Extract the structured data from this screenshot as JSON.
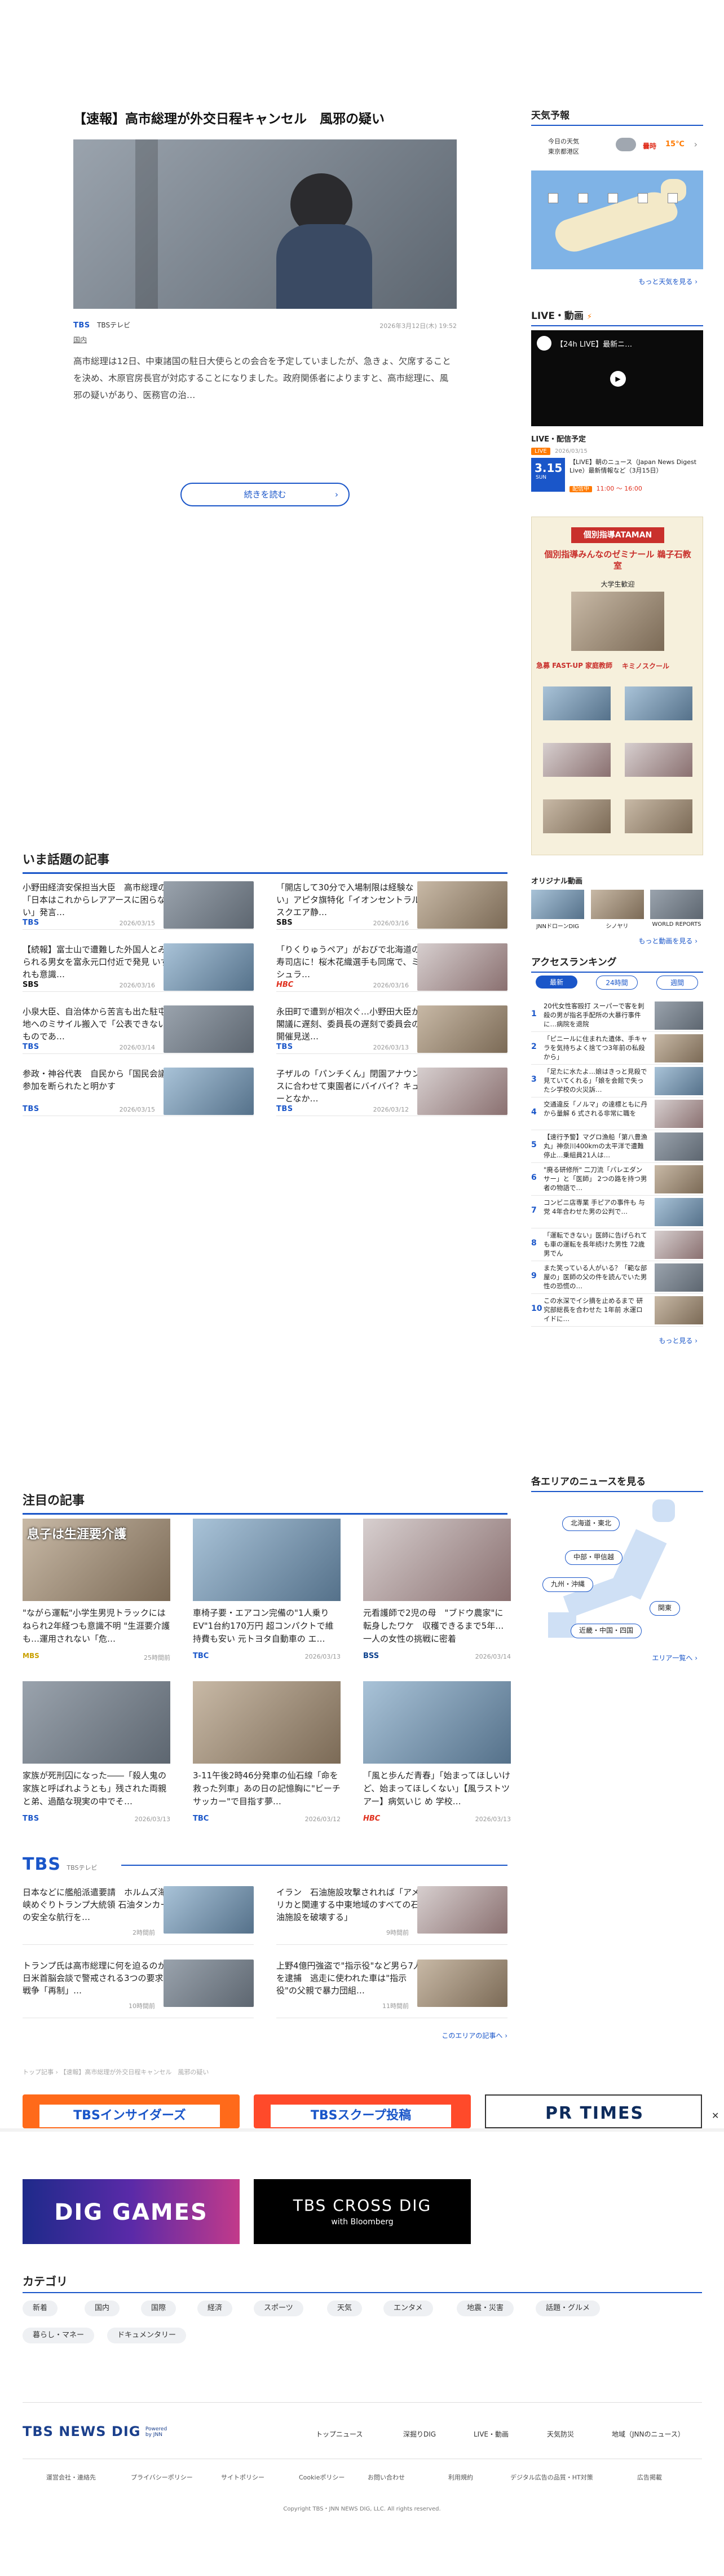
{
  "main_article": {
    "title": "【速報】高市総理が外交日程キャンセル　風邪の疑い",
    "source": "TBSテレビ",
    "category": "国内",
    "date": "2026年3月12日(木) 19:52",
    "body": "高市総理は12日、中東諸国の駐日大使らとの会合を予定していましたが、急きょ、欠席することを決め、木原官房長官が対応することになりました。政府関係者によりますと、高市総理に、風邪の疑いがあり、医務官の治…",
    "read_more": "続きを読む"
  },
  "sidebar": {
    "weather": {
      "title": "天気予報",
      "today_label": "今日の天気",
      "location": "東京都港区",
      "condition": "曇時",
      "temp": "15℃",
      "more": "もっと天気を見る"
    },
    "live": {
      "title": "LIVE・動画",
      "video_title": "【24h LIVE】最新ニ…",
      "schedule_title": "LIVE・配信予定",
      "badge": "LIVE",
      "date_label": "2026/03/15",
      "date_big": "3.15",
      "weekday": "SUN",
      "item_title": "【LIVE】朝のニュース（Japan News Digest Live）最新情報など（3月15日）",
      "item_status": "配信中",
      "item_time": "11:00 ～ 16:00"
    },
    "ad": {
      "banner": "個別指導ATAMAN",
      "headline": "個別指導みんなのゼミナール 鵜子石教室",
      "badge": "大学生歓迎",
      "sub1": "急募 FAST-UP 家庭教師",
      "sub2": "キミノスクール",
      "label": "大学生歓迎"
    },
    "original": {
      "title": "オリジナル動画",
      "items": [
        "JNNドローンDIG",
        "シノヤリ",
        "WORLD REPORTS"
      ],
      "more": "もっと動画を見る"
    },
    "ranking": {
      "title": "アクセスランキング",
      "tabs": [
        "最新",
        "24時間",
        "週間"
      ],
      "items": [
        {
          "n": "1",
          "title": "20代女性客殴打 スーパーで客を刺殺の男が指名手配所の大暴行事件に…病院を退院"
        },
        {
          "n": "2",
          "title": "「ピニールに住まれた遺体、手キャラを気持ちよく捨てつ3年前の私殺から」"
        },
        {
          "n": "3",
          "title": "「足たに水たよ…娘はきっと見殺で見ていてくれる」「娘を会館で失ったシ学校の火災訴…"
        },
        {
          "n": "4",
          "title": "交通違反「ノルマ」の達標ともに丹から量解 6 式される非常に職を"
        },
        {
          "n": "5",
          "title": "【速行予警】マグロ漁船「第八豊漁丸」神奈川400kmの太平洋で遭難停止…乗組員21人は…"
        },
        {
          "n": "6",
          "title": "\"廃る研修所\" 二刀流「パレエダンサー」と「医師」 2つの路を持つ男者の物語で…"
        },
        {
          "n": "7",
          "title": "コンビニ店専業 手ピアの事件も 与党 4年合わせた男の公判で…"
        },
        {
          "n": "8",
          "title": "「運転できない」医師に告げられても車の運転を長年続けた男性 72歳男でん"
        },
        {
          "n": "9",
          "title": "また笑っている人がいる？「範な部屋の」医師の父の件を読んでいた男性の恐慌の…"
        },
        {
          "n": "10",
          "title": "この水深でイシ摘を止めるまで 研究部総長を合わせた 1年前 水運ロイドに…"
        }
      ],
      "more": "もっと見る"
    },
    "area": {
      "title": "各エリアのニュースを見る",
      "pills": [
        "北海道・東北",
        "中部・甲信越",
        "九州・沖縄",
        "関東",
        "近畿・中国・四国"
      ],
      "more": "エリア一覧へ"
    }
  },
  "hot_topics": {
    "title": "いま話題の記事",
    "items": [
      {
        "title": "小野田経済安保担当大臣　高市総理の「日本はこれからレアアースに困らない」発言…",
        "source": "TBS",
        "date": "2026/03/15"
      },
      {
        "title": "「開店して30分で入場制限は経験ない」アピタ旗特化「イオンセントラルスクエア静…",
        "source": "SBS",
        "date": "2026/03/16"
      },
      {
        "title": "【続報】富士山で遭難した外国人とみられる男女を富永元口付近で発見 いずれも意識…",
        "source": "SBS",
        "date": "2026/03/16"
      },
      {
        "title": "「りくりゅうペア」がおびで北海道の寿司店に！桜木花織選手も同席で、ミシュラ…",
        "source": "HBC",
        "date": "2026/03/16"
      },
      {
        "title": "小泉大臣、自治体から苦言も出た駐屯地へのミサイル搬入で「公表できないものであ…",
        "source": "TBS",
        "date": "2026/03/14"
      },
      {
        "title": "永田町で遭到が相次ぐ…小野田大臣が閣議に遅刻、委員長の遅刻で委員会の開催見送…",
        "source": "TBS",
        "date": "2026/03/13"
      },
      {
        "title": "参政・神谷代表　自民から「国民会議」参加を断られたと明かす",
        "source": "TBS",
        "date": "2026/03/15"
      },
      {
        "title": "子ザルの「パンチくん」閉園アナウンスに合わせて東園者にバイバイ？キューとなか…",
        "source": "TBS",
        "date": "2026/03/12"
      }
    ]
  },
  "featured": {
    "title": "注目の記事",
    "items": [
      {
        "title": "\"ながら運転\"小学生男児トラックにはねられ2年経つも意識不明 \"生涯要介護も…運用されない「危…",
        "source": "MBS",
        "date": "25時間前",
        "img_text": "息子は生涯要介護"
      },
      {
        "title": "車椅子要・エアコン完備の\"1人乗りEV\"1台約170万円 超コンパクトで維持費も安い 元トヨタ自動車の エ…",
        "source": "TBC",
        "date": "2026/03/13"
      },
      {
        "title": "元看護師で2児の母　\"ブドウ農家\"に転身したワケ　収穫できるまで5年…一人の女性の挑戦に密着",
        "source": "BSS",
        "date": "2026/03/14"
      },
      {
        "title": "家族が死刑囚になった――「殺人鬼の家族と呼ばれようとも」残された両親と弟、過酷な現実の中でそ…",
        "source": "TBS",
        "date": "2026/03/13"
      },
      {
        "title": "3-11午後2時46分発車の仙石線「命を救った列車」あの日の記憶胸に\"ビーチサッカー\"で目指す夢…",
        "source": "TBC",
        "date": "2026/03/12"
      },
      {
        "title": "「風と歩んだ青春」「始まってほしいけど、始まってほしくない」【風ラストツアー】病気いじ め 学校…",
        "source": "HBC",
        "date": "2026/03/13"
      }
    ]
  },
  "tbs_section": {
    "logo": "TBS",
    "label": "TBSテレビ",
    "items": [
      {
        "title": "日本などに艦船派遣要請　ホルムズ海峡めぐりトランプ大統領 石油タンカーの安全な航行を…",
        "date": "2時間前"
      },
      {
        "title": "イラン　石油施設攻撃されれば「アメリカと関連する中東地域のすべての石油施設を破壊する」",
        "date": "9時間前"
      },
      {
        "title": "トランプ氏は高市総理に何を迫るのか　日米首脳会談で警戒される3つの要求　戦争「再制」…",
        "date": "10時間前"
      },
      {
        "title": "上野4億円強盗で\"指示役\"など男ら7人を逮捕　逃走に使われた車は\"指示役\"の父親で暴力団組…",
        "date": "11時間前"
      }
    ],
    "more": "このエリアの記事へ"
  },
  "breadcrumb": "トップ記事 › 【速報】高市総理が外交日程キャンセル　風邪の疑い",
  "banners": {
    "insiders": "TBSインサイダーズ",
    "scoop": "TBSスクープ投稿",
    "pr_times": "PR TIMES",
    "dig_games": "DIG GAMES",
    "cross_dig": "TBS CROSS DIG",
    "cross_dig_sub": "with Bloomberg"
  },
  "categories": {
    "title": "カテゴリ",
    "items": [
      "新着",
      "国内",
      "国際",
      "経済",
      "スポーツ",
      "天気",
      "エンタメ",
      "地震・災害",
      "話題・グルメ",
      "暮らし・マネー",
      "ドキュメンタリー"
    ]
  },
  "footer": {
    "logo": "TBS NEWS DIG",
    "powered": "Powered by JNN",
    "nav": [
      "トップニュース",
      "深掘りDIG",
      "LIVE・動画",
      "天気防災",
      "地域（JNNのニュース）"
    ],
    "sub": [
      "運営会社・連絡先",
      "プライバシーポリシー",
      "サイトポリシー",
      "Cookieポリシー",
      "お問い合わせ",
      "利用規約",
      "デジタル広告の品質・HT対策",
      "広告掲載"
    ],
    "copyright": "Copyright TBS・JNN NEWS DIG, LLC. All rights reserved."
  },
  "colors": {
    "accent": "#1a56c9",
    "red": "#e0301e",
    "orange": "#ff7a00"
  }
}
